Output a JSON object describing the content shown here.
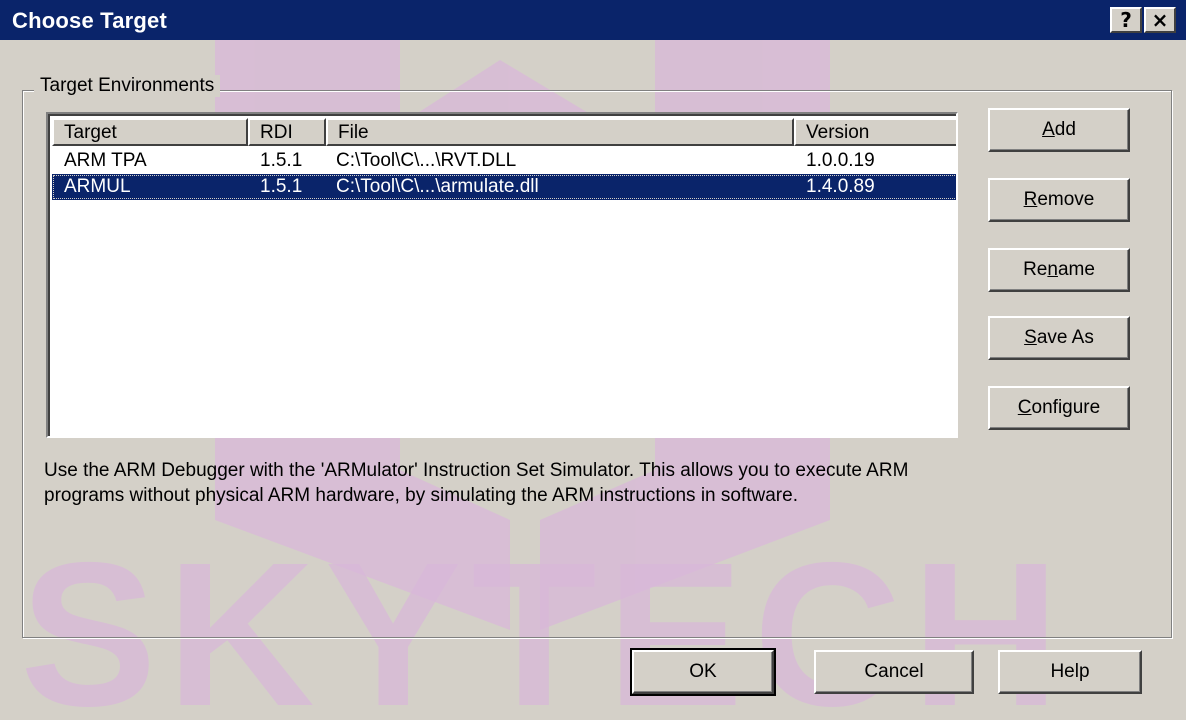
{
  "window": {
    "title": "Choose Target",
    "help_caption": "?",
    "close_caption": "×"
  },
  "group": {
    "label": "Target Environments"
  },
  "list": {
    "columns": [
      "Target",
      "RDI",
      "File",
      "Version"
    ],
    "rows": [
      {
        "target": "ARM TPA",
        "rdi": "1.5.1",
        "file": "C:\\Tool\\C\\...\\RVT.DLL",
        "version": "1.0.0.19",
        "selected": false
      },
      {
        "target": "ARMUL",
        "rdi": "1.5.1",
        "file": "C:\\Tool\\C\\...\\armulate.dll",
        "version": "1.4.0.89",
        "selected": true
      }
    ]
  },
  "side_buttons": {
    "add": {
      "before": "",
      "mnemonic": "A",
      "after": "dd"
    },
    "remove": {
      "before": "",
      "mnemonic": "R",
      "after": "emove"
    },
    "rename": {
      "before": "Re",
      "mnemonic": "n",
      "after": "ame"
    },
    "save_as": {
      "before": "",
      "mnemonic": "S",
      "after": "ave As"
    },
    "configure": {
      "before": "",
      "mnemonic": "C",
      "after": "onfigure"
    }
  },
  "description": "Use the ARM Debugger with the 'ARMulator' Instruction Set Simulator. This allows you to execute ARM programs without physical ARM hardware, by simulating the ARM instructions in software.",
  "footer": {
    "ok_label": "OK",
    "cancel_label": "Cancel",
    "help_label": "Help"
  },
  "watermark": {
    "text": "SKYTECH",
    "color": "#d9b8d9"
  },
  "colors": {
    "titlebar": "#0a246a",
    "selection": "#0a246a",
    "face": "#d4d0c8"
  }
}
